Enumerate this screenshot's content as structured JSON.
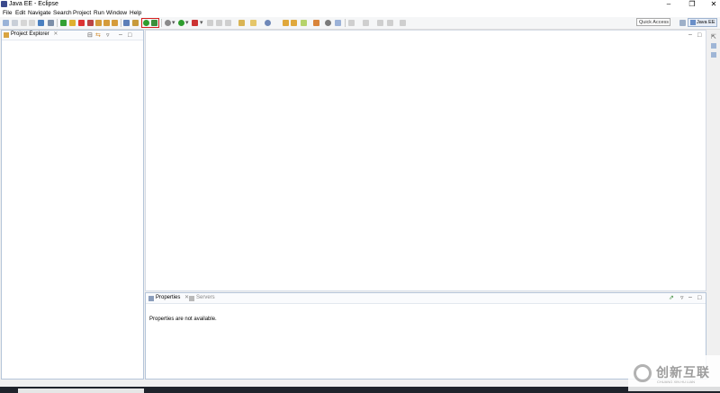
{
  "window": {
    "title": "Java EE - Eclipse"
  },
  "menu": [
    "File",
    "Edit",
    "Navigate",
    "Search",
    "Project",
    "Run",
    "Window",
    "Help"
  ],
  "toolbar": {
    "quick_access_label": "Quick Access",
    "perspective_label": "Java EE",
    "highlighted_buttons": [
      "start-server-icon",
      "publish-icon"
    ]
  },
  "project_explorer": {
    "tab_label": "Project Explorer",
    "close_glyph": "✕"
  },
  "bottom_panel": {
    "tabs": [
      {
        "label": "Properties",
        "active": true
      },
      {
        "label": "Servers",
        "active": false
      }
    ],
    "close_glyph": "✕",
    "message": "Properties are not available."
  },
  "watermark": {
    "text_cn": "创新互联",
    "text_en": "CHUANG XIN HU LIAN"
  },
  "colors": {
    "highlight_border": "#d42020",
    "panel_border": "#b5c5d9",
    "background": "#f0f0f0"
  }
}
